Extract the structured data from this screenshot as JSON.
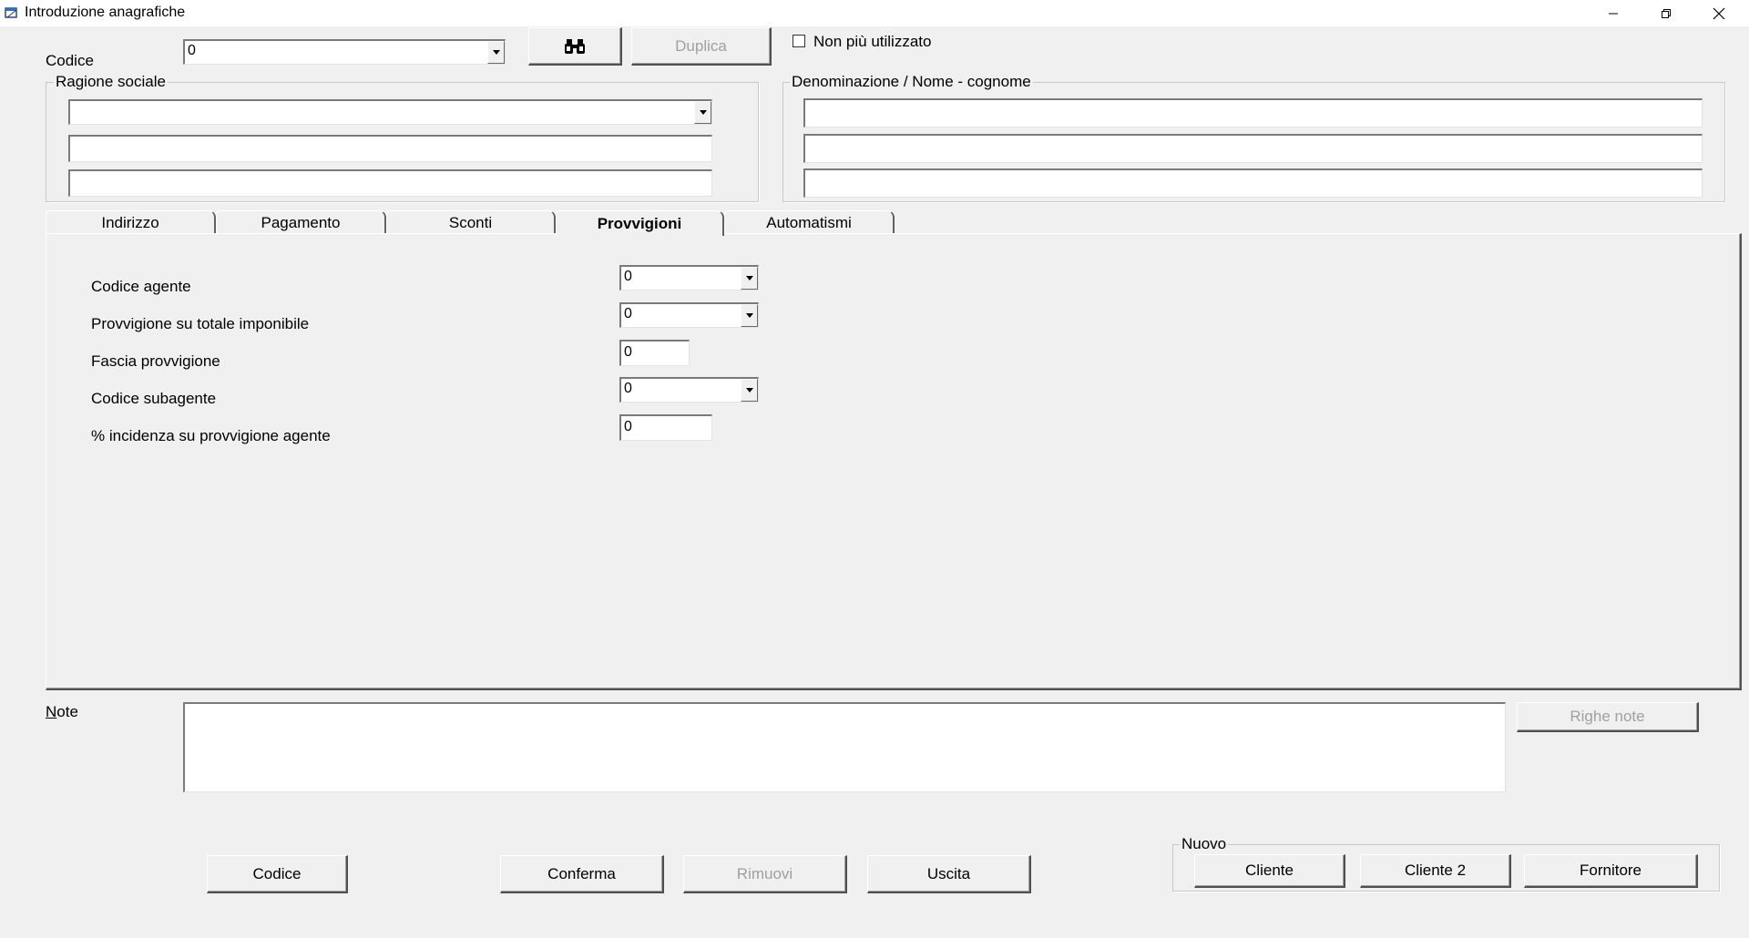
{
  "window": {
    "title": "Introduzione anagrafiche",
    "icon": "app-window-icon",
    "controls": [
      "minimize-icon",
      "restore-icon",
      "close-icon"
    ]
  },
  "header": {
    "codice_label": "Codice",
    "codice_value": "0",
    "search_icon": "binoculars-icon",
    "duplica_label": "Duplica",
    "non_piu_utilizzato_label": "Non più utilizzato",
    "non_piu_utilizzato_checked": false
  },
  "ragione_sociale": {
    "title": "Ragione sociale",
    "line1": "",
    "line2": "",
    "line3": ""
  },
  "denominazione": {
    "title": "Denominazione / Nome - cognome",
    "line1": "",
    "line2": "",
    "line3": ""
  },
  "tabs": [
    {
      "label": "Indirizzo",
      "active": false
    },
    {
      "label": "Pagamento",
      "active": false
    },
    {
      "label": "Sconti",
      "active": false
    },
    {
      "label": "Provvigioni",
      "active": true
    },
    {
      "label": "Automatismi",
      "active": false
    }
  ],
  "provvigioni": {
    "codice_agente": {
      "label": "Codice agente",
      "value": "0"
    },
    "provvigione_totale": {
      "label": "Provvigione su totale imponibile",
      "value": "0"
    },
    "fascia_provvigione": {
      "label": "Fascia provvigione",
      "value": "0"
    },
    "codice_subagente": {
      "label": "Codice subagente",
      "value": "0"
    },
    "incidenza": {
      "label": "% incidenza su provvigione agente",
      "value": "0"
    }
  },
  "note": {
    "label": "Note",
    "value": "",
    "righe_note_label": "Righe note"
  },
  "actions": {
    "codice_label": "Codice",
    "conferma_label": "Conferma",
    "rimuovi_label": "Rimuovi",
    "uscita_label": "Uscita"
  },
  "nuovo": {
    "title": "Nuovo",
    "cliente_label": "Cliente",
    "cliente2_label": "Cliente 2",
    "fornitore_label": "Fornitore"
  }
}
